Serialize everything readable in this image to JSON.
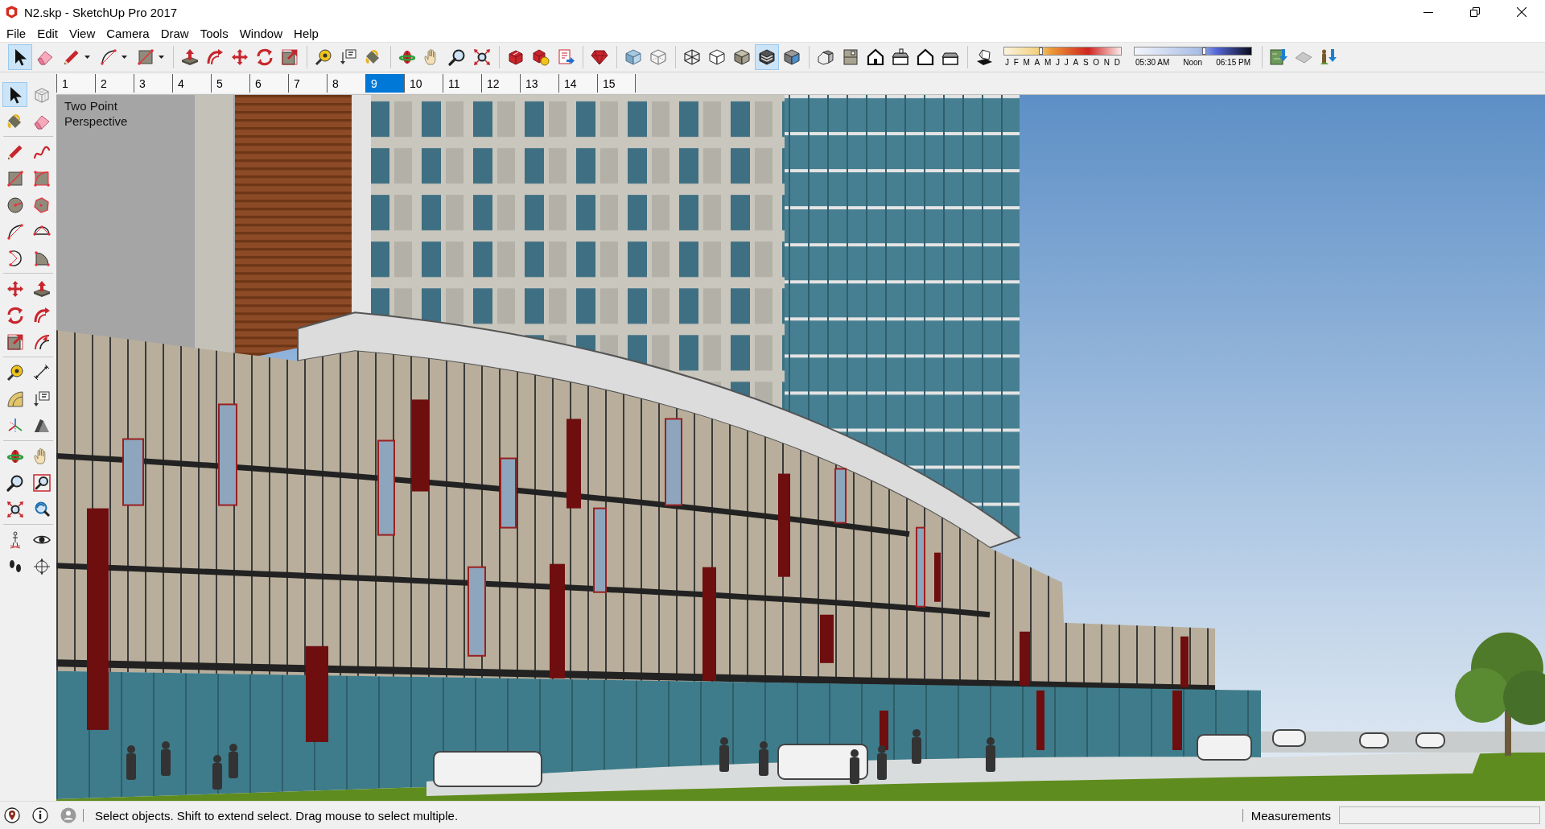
{
  "window": {
    "title": "N2.skp - SketchUp Pro 2017"
  },
  "menu": [
    "File",
    "Edit",
    "View",
    "Camera",
    "Draw",
    "Tools",
    "Window",
    "Help"
  ],
  "toolbar": {
    "groups": [
      {
        "items": [
          {
            "kind": "select",
            "selected": true,
            "dropdown": false
          },
          {
            "kind": "eraser",
            "selected": false,
            "dropdown": false
          },
          {
            "kind": "line",
            "selected": false,
            "dropdown": true
          },
          {
            "kind": "arc",
            "selected": false,
            "dropdown": true
          },
          {
            "kind": "rectangle",
            "selected": false,
            "dropdown": true
          }
        ]
      },
      {
        "items": [
          {
            "kind": "pushpull",
            "selected": false,
            "dropdown": false
          },
          {
            "kind": "followme",
            "selected": false,
            "dropdown": false
          },
          {
            "kind": "move",
            "selected": false,
            "dropdown": false
          },
          {
            "kind": "rotate",
            "selected": false,
            "dropdown": false
          },
          {
            "kind": "scale",
            "selected": false,
            "dropdown": false
          }
        ]
      },
      {
        "items": [
          {
            "kind": "tape",
            "selected": false,
            "dropdown": false
          },
          {
            "kind": "text",
            "selected": false,
            "dropdown": false
          },
          {
            "kind": "paint",
            "selected": false,
            "dropdown": false
          }
        ]
      },
      {
        "items": [
          {
            "kind": "orbit",
            "selected": false,
            "dropdown": false
          },
          {
            "kind": "pan",
            "selected": false,
            "dropdown": false
          },
          {
            "kind": "zoom",
            "selected": false,
            "dropdown": false
          },
          {
            "kind": "zoomextents",
            "selected": false,
            "dropdown": false
          }
        ]
      },
      {
        "items": [
          {
            "kind": "warehouse",
            "selected": false,
            "dropdown": false
          },
          {
            "kind": "extension",
            "selected": false,
            "dropdown": false
          },
          {
            "kind": "layout",
            "selected": false,
            "dropdown": false
          }
        ]
      },
      {
        "items": [
          {
            "kind": "ruby",
            "selected": false,
            "dropdown": false
          }
        ]
      },
      {
        "items": [
          {
            "kind": "xray",
            "selected": false,
            "dropdown": false
          },
          {
            "kind": "backedges",
            "selected": false,
            "dropdown": false
          }
        ]
      },
      {
        "items": [
          {
            "kind": "wireframe",
            "selected": false,
            "dropdown": false
          },
          {
            "kind": "hiddenline",
            "selected": false,
            "dropdown": false
          },
          {
            "kind": "shaded",
            "selected": false,
            "dropdown": false
          },
          {
            "kind": "textured",
            "selected": true,
            "dropdown": false
          },
          {
            "kind": "monochrome",
            "selected": false,
            "dropdown": false
          }
        ]
      },
      {
        "items": [
          {
            "kind": "iso",
            "selected": false,
            "dropdown": false
          },
          {
            "kind": "top",
            "selected": false,
            "dropdown": false
          },
          {
            "kind": "front",
            "selected": false,
            "dropdown": false
          },
          {
            "kind": "right",
            "selected": false,
            "dropdown": false
          },
          {
            "kind": "back",
            "selected": false,
            "dropdown": false
          },
          {
            "kind": "left",
            "selected": false,
            "dropdown": false
          }
        ]
      },
      {
        "items": [
          {
            "kind": "shadows",
            "selected": false,
            "dropdown": false
          },
          {
            "kind": "month-slider",
            "labels": [
              "J",
              "F",
              "M",
              "A",
              "M",
              "J",
              "J",
              "A",
              "S",
              "O",
              "N",
              "D"
            ],
            "level": 0.31
          },
          {
            "kind": "time-slider",
            "labels": [
              "05:30 AM",
              "Noon",
              "06:15 PM"
            ],
            "level": 0.6
          }
        ]
      },
      {
        "items": [
          {
            "kind": "location",
            "selected": false,
            "dropdown": false
          },
          {
            "kind": "terrain",
            "selected": false,
            "dropdown": false
          },
          {
            "kind": "photo",
            "selected": false,
            "dropdown": false
          }
        ]
      }
    ]
  },
  "scenes": [
    {
      "label": "1",
      "selected": false
    },
    {
      "label": "2",
      "selected": false
    },
    {
      "label": "3",
      "selected": false
    },
    {
      "label": "4",
      "selected": false
    },
    {
      "label": "5",
      "selected": false
    },
    {
      "label": "6",
      "selected": false
    },
    {
      "label": "7",
      "selected": false
    },
    {
      "label": "8",
      "selected": false
    },
    {
      "label": "9",
      "selected": true
    },
    {
      "label": "10",
      "selected": false
    },
    {
      "label": "11",
      "selected": false
    },
    {
      "label": "12",
      "selected": false
    },
    {
      "label": "13",
      "selected": false
    },
    {
      "label": "14",
      "selected": false
    },
    {
      "label": "15",
      "selected": false
    }
  ],
  "tool_palette": {
    "groups": [
      {
        "tools": [
          {
            "kind": "select",
            "selected": true
          },
          {
            "kind": "component",
            "selected": false
          },
          {
            "kind": "paint",
            "selected": false
          },
          {
            "kind": "eraser",
            "selected": false
          }
        ]
      },
      {
        "tools": [
          {
            "kind": "line",
            "selected": false
          },
          {
            "kind": "freehand",
            "selected": false
          },
          {
            "kind": "rectangle",
            "selected": false
          },
          {
            "kind": "rotatedrect",
            "selected": false
          },
          {
            "kind": "circle",
            "selected": false
          },
          {
            "kind": "polygon",
            "selected": false
          },
          {
            "kind": "arc",
            "selected": false
          },
          {
            "kind": "arc3",
            "selected": false
          },
          {
            "kind": "arccenter",
            "selected": false
          },
          {
            "kind": "pie",
            "selected": false
          }
        ]
      },
      {
        "tools": [
          {
            "kind": "move",
            "selected": false
          },
          {
            "kind": "pushpull",
            "selected": false
          },
          {
            "kind": "rotate",
            "selected": false
          },
          {
            "kind": "followme",
            "selected": false
          },
          {
            "kind": "scale",
            "selected": false
          },
          {
            "kind": "offset",
            "selected": false
          }
        ]
      },
      {
        "tools": [
          {
            "kind": "tape",
            "selected": false
          },
          {
            "kind": "dimension",
            "selected": false
          },
          {
            "kind": "protractor",
            "selected": false
          },
          {
            "kind": "text",
            "selected": false
          },
          {
            "kind": "axes",
            "selected": false
          },
          {
            "kind": "text3d",
            "selected": false
          }
        ]
      },
      {
        "tools": [
          {
            "kind": "orbit",
            "selected": false
          },
          {
            "kind": "pan",
            "selected": false
          },
          {
            "kind": "zoom",
            "selected": false
          },
          {
            "kind": "zoomwindow",
            "selected": false
          },
          {
            "kind": "zoomextents",
            "selected": false
          },
          {
            "kind": "previous",
            "selected": false
          }
        ]
      },
      {
        "tools": [
          {
            "kind": "position",
            "selected": false
          },
          {
            "kind": "lookaround",
            "selected": false
          },
          {
            "kind": "walk",
            "selected": false
          },
          {
            "kind": "section",
            "selected": false
          }
        ]
      }
    ]
  },
  "viewport": {
    "camera_label": "Two Point Perspective"
  },
  "status_bar": {
    "message": "Select objects. Shift to extend select. Drag mouse to select multiple.",
    "measurements_label": "Measurements"
  }
}
